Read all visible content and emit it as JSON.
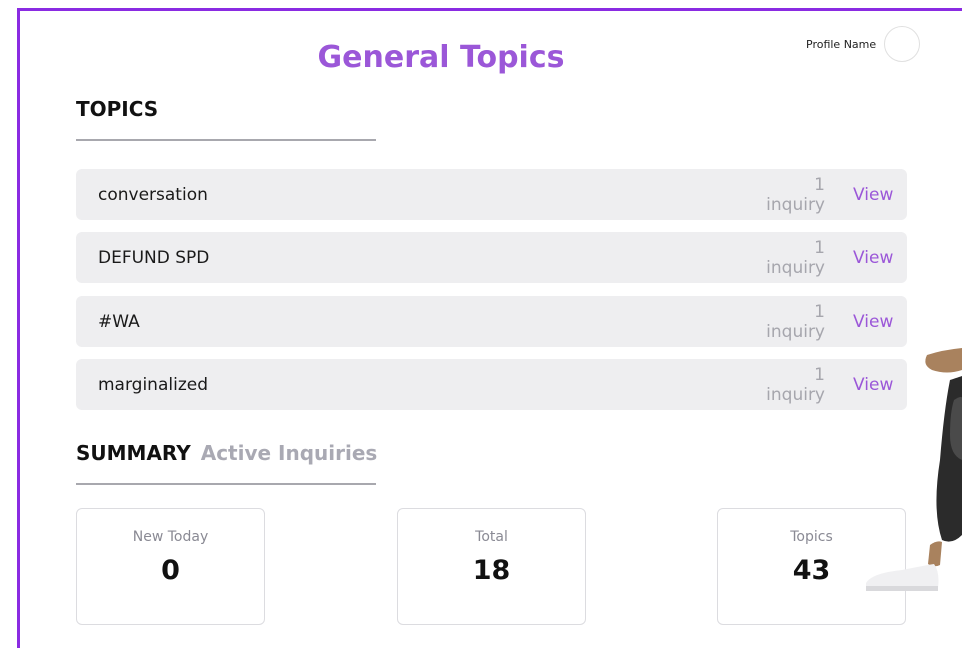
{
  "header": {
    "title": "General Topics",
    "profile_name": "Profile Name"
  },
  "topics_section": {
    "heading": "TOPICS",
    "items": [
      {
        "name": "conversation",
        "count": "1 inquiry",
        "action": "View"
      },
      {
        "name": "DEFUND SPD",
        "count": "1 inquiry",
        "action": "View"
      },
      {
        "name": "#WA",
        "count": "1 inquiry",
        "action": "View"
      },
      {
        "name": "marginalized",
        "count": "1 inquiry",
        "action": "View"
      }
    ]
  },
  "summary_section": {
    "heading": "SUMMARY",
    "subheading": "Active Inquiries",
    "cards": [
      {
        "label": "New Today",
        "value": "0"
      },
      {
        "label": "Total",
        "value": "18"
      },
      {
        "label": "Topics",
        "value": "43"
      }
    ]
  },
  "colors": {
    "accent": "#9b57d8",
    "frame": "#8a2be2",
    "row_background": "#eeeef0",
    "muted_text": "#a6a6ad"
  }
}
